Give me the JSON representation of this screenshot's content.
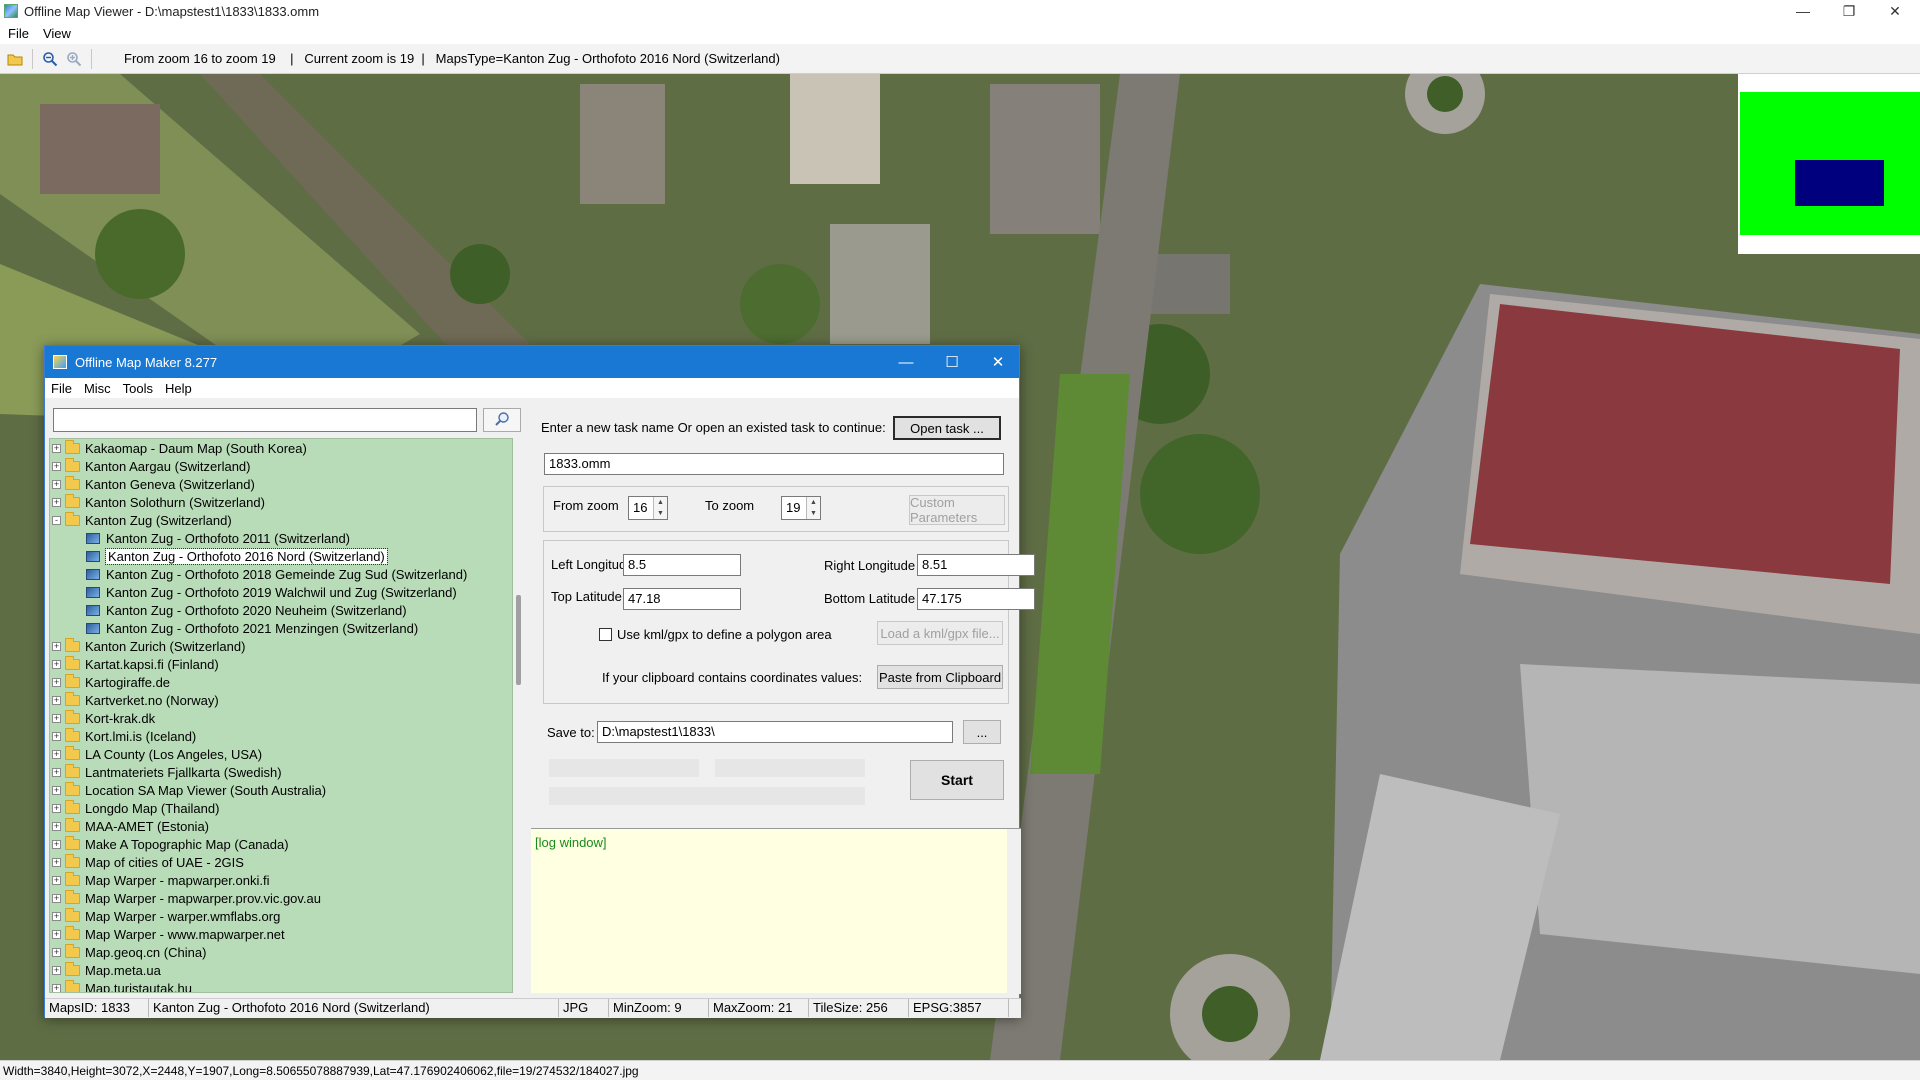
{
  "viewer": {
    "title": "Offline Map Viewer - D:\\mapstest1\\1833\\1833.omm",
    "menu": [
      "File",
      "View"
    ],
    "toolbar_status": "From zoom 16 to zoom 19    |   Current zoom is 19  |   MapsType=Kanton Zug - Orthofoto 2016 Nord (Switzerland)",
    "status_bar": "Width=3840,Height=3072,X=2448,Y=1907,Long=8.50655078887939,Lat=47.176902406062,file=19/274532/184027.jpg",
    "minimap_colors": {
      "background": "#00ff00",
      "viewport": "#00007f"
    }
  },
  "dialog": {
    "title": "Offline Map Maker 8.277",
    "menu": [
      "File",
      "Misc",
      "Tools",
      "Help"
    ],
    "search": {
      "value": "",
      "placeholder": ""
    },
    "tree": [
      {
        "label": "Kakaomap - Daum Map (South Korea)",
        "type": "folder",
        "expander": "+"
      },
      {
        "label": "Kanton Aargau (Switzerland)",
        "type": "folder",
        "expander": "+"
      },
      {
        "label": "Kanton Geneva (Switzerland)",
        "type": "folder",
        "expander": "+"
      },
      {
        "label": "Kanton Solothurn (Switzerland)",
        "type": "folder",
        "expander": "+"
      },
      {
        "label": "Kanton Zug (Switzerland)",
        "type": "folder",
        "expander": "-"
      },
      {
        "label": "Kanton Zug - Orthofoto 2011 (Switzerland)",
        "type": "map"
      },
      {
        "label": "Kanton Zug - Orthofoto 2016 Nord (Switzerland)",
        "type": "map",
        "selected": true
      },
      {
        "label": "Kanton Zug - Orthofoto 2018 Gemeinde Zug Sud (Switzerland)",
        "type": "map"
      },
      {
        "label": "Kanton Zug - Orthofoto 2019 Walchwil und Zug (Switzerland)",
        "type": "map"
      },
      {
        "label": "Kanton Zug - Orthofoto 2020 Neuheim (Switzerland)",
        "type": "map"
      },
      {
        "label": "Kanton Zug - Orthofoto 2021 Menzingen (Switzerland)",
        "type": "map"
      },
      {
        "label": "Kanton Zurich (Switzerland)",
        "type": "folder",
        "expander": "+"
      },
      {
        "label": "Kartat.kapsi.fi (Finland)",
        "type": "folder",
        "expander": "+"
      },
      {
        "label": "Kartogiraffe.de",
        "type": "folder",
        "expander": "+"
      },
      {
        "label": "Kartverket.no (Norway)",
        "type": "folder",
        "expander": "+"
      },
      {
        "label": "Kort-krak.dk",
        "type": "folder",
        "expander": "+"
      },
      {
        "label": "Kort.lmi.is (Iceland)",
        "type": "folder",
        "expander": "+"
      },
      {
        "label": "LA County (Los Angeles, USA)",
        "type": "folder",
        "expander": "+"
      },
      {
        "label": "Lantmateriets Fjallkarta (Swedish)",
        "type": "folder",
        "expander": "+"
      },
      {
        "label": "Location SA Map Viewer (South Australia)",
        "type": "folder",
        "expander": "+"
      },
      {
        "label": "Longdo Map (Thailand)",
        "type": "folder",
        "expander": "+"
      },
      {
        "label": "MAA-AMET (Estonia)",
        "type": "folder",
        "expander": "+"
      },
      {
        "label": "Make A Topographic Map (Canada)",
        "type": "folder",
        "expander": "+"
      },
      {
        "label": "Map of cities of UAE - 2GIS",
        "type": "folder",
        "expander": "+"
      },
      {
        "label": "Map Warper - mapwarper.onki.fi",
        "type": "folder",
        "expander": "+"
      },
      {
        "label": "Map Warper - mapwarper.prov.vic.gov.au",
        "type": "folder",
        "expander": "+"
      },
      {
        "label": "Map Warper - warper.wmflabs.org",
        "type": "folder",
        "expander": "+"
      },
      {
        "label": "Map Warper - www.mapwarper.net",
        "type": "folder",
        "expander": "+"
      },
      {
        "label": "Map.geoq.cn (China)",
        "type": "folder",
        "expander": "+"
      },
      {
        "label": "Map.meta.ua",
        "type": "folder",
        "expander": "+"
      },
      {
        "label": "Map.turistautak.hu",
        "type": "folder",
        "expander": "+"
      }
    ],
    "task_prompt": "Enter a new task name Or open an existed task to continue:",
    "open_task_label": "Open task ...",
    "task_name": "1833.omm",
    "from_zoom_label": "From zoom",
    "from_zoom": "16",
    "to_zoom_label": "To zoom",
    "to_zoom": "19",
    "custom_params_label": "Custom Parameters",
    "left_lon_label": "Left Longitude",
    "left_lon": "8.5",
    "right_lon_label": "Right Longitude",
    "right_lon": "8.51",
    "top_lat_label": "Top Latitude",
    "top_lat": "47.18",
    "bottom_lat_label": "Bottom Latitude",
    "bottom_lat": "47.175",
    "kml_label": "Use kml/gpx to define a polygon area",
    "load_kml_label": "Load a kml/gpx file...",
    "clipboard_prompt": "If your clipboard contains coordinates values:",
    "paste_label": "Paste from Clipboard",
    "save_to_label": "Save to:",
    "save_to": "D:\\mapstest1\\1833\\",
    "browse_label": "...",
    "start_label": "Start",
    "log_text": "[log window]",
    "status": {
      "maps_id": "MapsID: 1833",
      "map_name": "Kanton Zug - Orthofoto 2016 Nord (Switzerland)",
      "format": "JPG",
      "min_zoom": "MinZoom: 9",
      "max_zoom": "MaxZoom: 21",
      "tile_size": "TileSize: 256",
      "epsg": "EPSG:3857"
    }
  }
}
